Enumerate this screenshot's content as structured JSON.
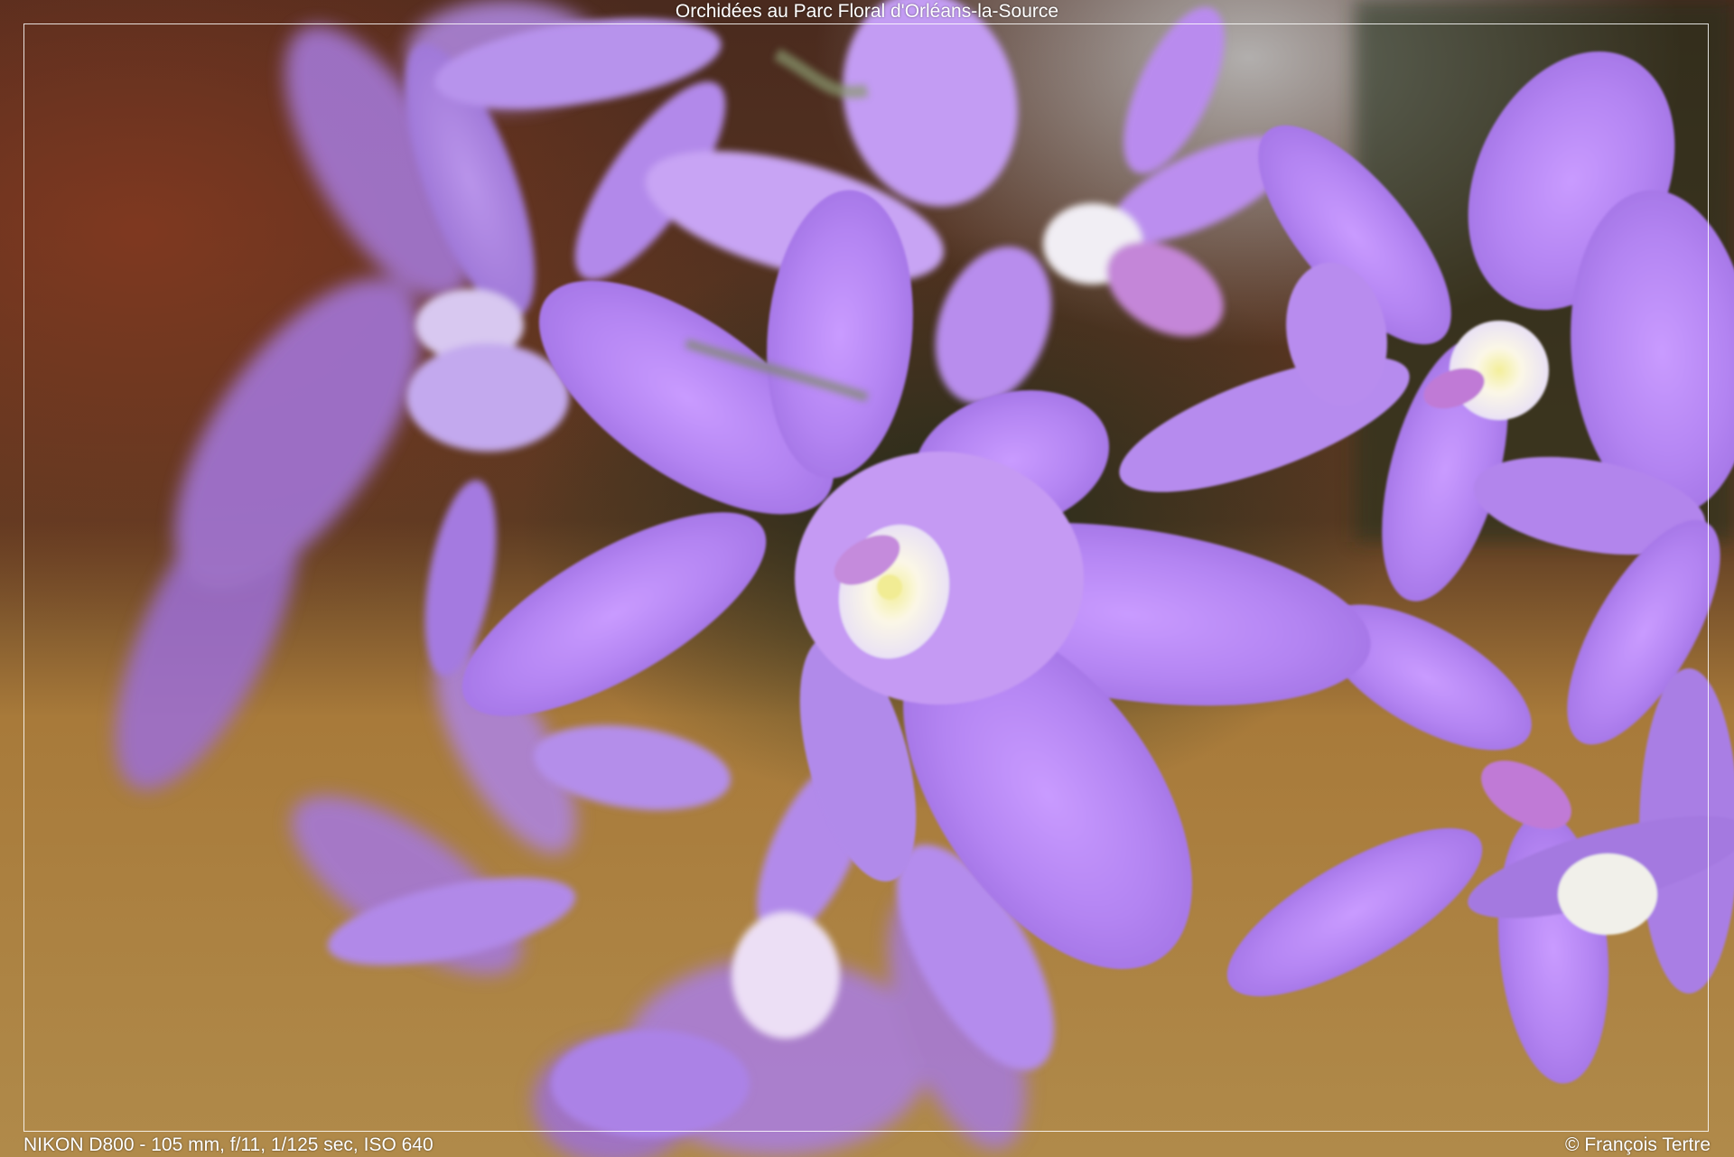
{
  "header": {
    "title": "Orchidées au Parc Floral d'Orléans-la-Source"
  },
  "footer": {
    "exif": "NIKON D800 - 105 mm, f/11, 1/125 sec, ISO 640",
    "copyright": "© François Tertre"
  },
  "colors": {
    "petal": "#b07ff0",
    "petal_light": "#d4b0ff",
    "throat": "#f4f2e2",
    "background_wood": "#a87a3a",
    "background_dark": "#3b2a1e"
  }
}
